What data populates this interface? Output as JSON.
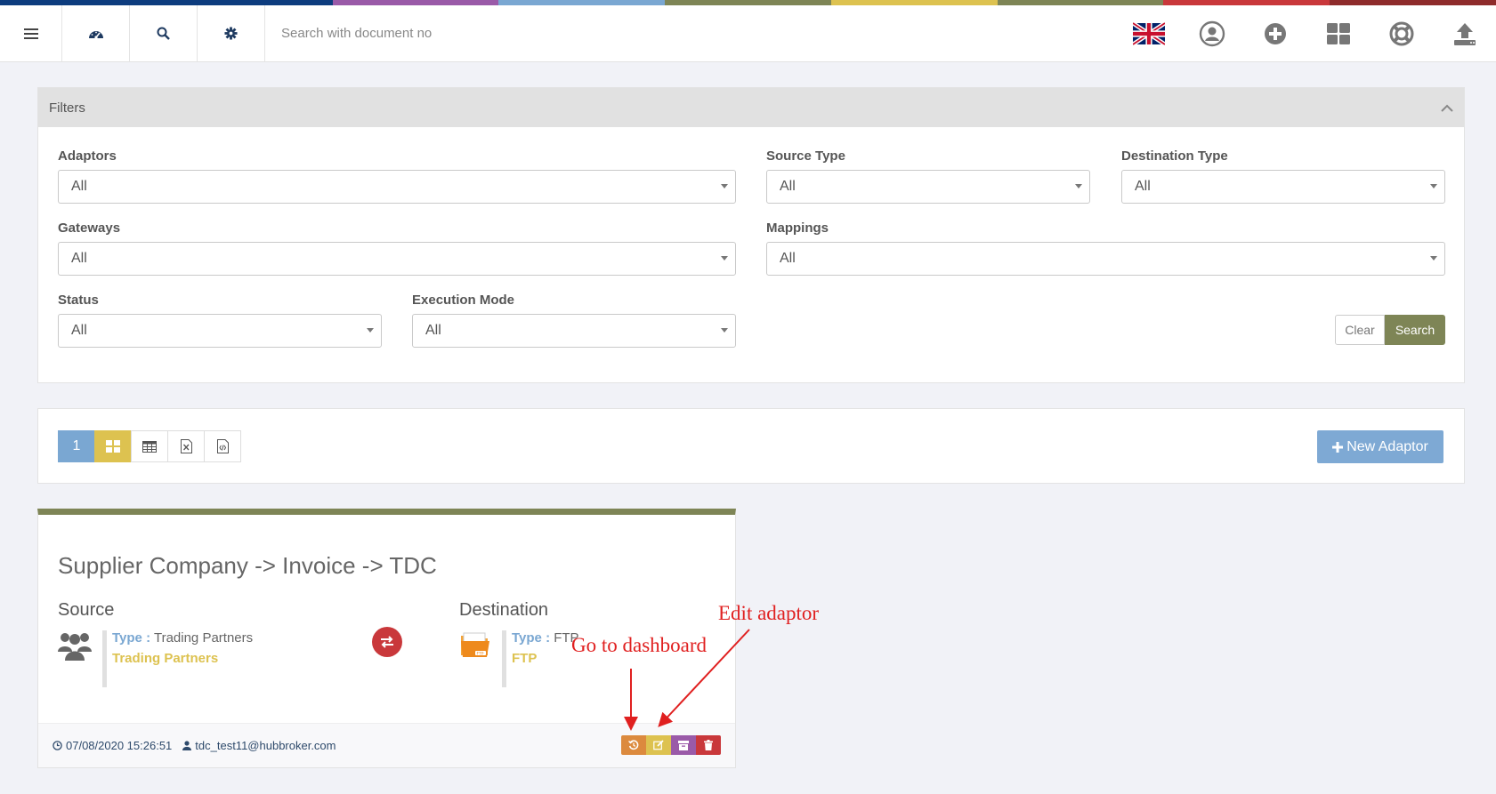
{
  "colors": {
    "strip": [
      "#0d3c7e",
      "#0d3c7e",
      "#9a5aa8",
      "#7aa7d2",
      "#7e8556",
      "#ddc250",
      "#7e8556",
      "#c9383b",
      "#8e2b2b"
    ],
    "olive": "#7e8556",
    "yellow": "#ddc250",
    "blue": "#7aa7d2",
    "red": "#c9383b",
    "purple": "#9a5aa8",
    "orange": "#dc8a3e"
  },
  "topbar": {
    "left_icons": [
      "menu-icon",
      "dashboard-gauge-icon",
      "search-icon",
      "gear-icon"
    ],
    "search_placeholder": "Search with document no",
    "right_icons": [
      "uk-flag-icon",
      "user-circle-icon",
      "plus-circle-icon",
      "apps-grid-icon",
      "lifebuoy-icon",
      "upload-icon"
    ]
  },
  "filters": {
    "title": "Filters",
    "adaptors": {
      "label": "Adaptors",
      "value": "All"
    },
    "source_type": {
      "label": "Source Type",
      "value": "All"
    },
    "destination_type": {
      "label": "Destination Type",
      "value": "All"
    },
    "gateways": {
      "label": "Gateways",
      "value": "All"
    },
    "mappings": {
      "label": "Mappings",
      "value": "All"
    },
    "status": {
      "label": "Status",
      "value": "All"
    },
    "execution_mode": {
      "label": "Execution Mode",
      "value": "All"
    },
    "clear_label": "Clear",
    "search_label": "Search"
  },
  "toolbar": {
    "page_number": "1",
    "view_icons": [
      "grid-view-icon",
      "table-view-icon",
      "excel-export-icon",
      "code-export-icon"
    ],
    "new_adaptor_label": "New Adaptor"
  },
  "card": {
    "title": "Supplier Company -> Invoice -> TDC",
    "source": {
      "heading": "Source",
      "type_label": "Type :",
      "type_value": "Trading Partners",
      "name": "Trading Partners"
    },
    "destination": {
      "heading": "Destination",
      "type_label": "Type :",
      "type_value": "FTP",
      "name": "FTP"
    },
    "footer": {
      "timestamp": "07/08/2020 15:26:51",
      "user": "tdc_test11@hubbroker.com"
    }
  },
  "annotations": {
    "go_to_dashboard": "Go to dashboard",
    "edit_adaptor": "Edit adaptor"
  }
}
